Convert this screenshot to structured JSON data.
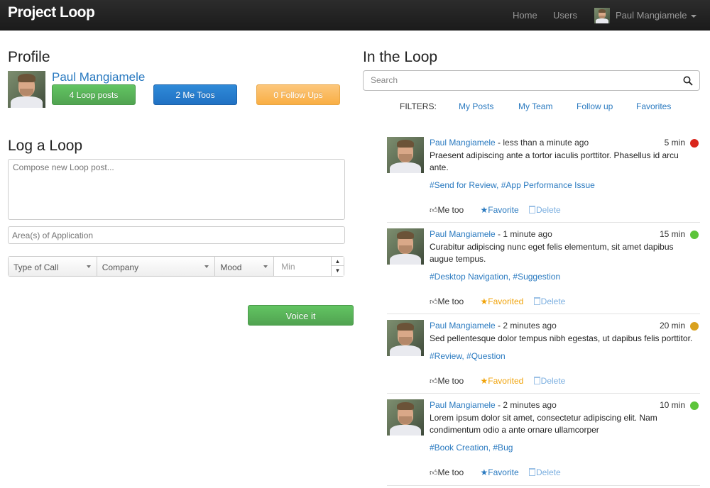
{
  "nav": {
    "brand": "Project Loop",
    "home": "Home",
    "users": "Users",
    "user_name": "Paul Mangiamele"
  },
  "profile": {
    "title": "Profile",
    "name": "Paul Mangiamele",
    "loop_posts": "4 Loop posts",
    "me_toos": "2 Me Toos",
    "follow_ups": "0 Follow Ups"
  },
  "log": {
    "title": "Log a Loop",
    "compose_placeholder": "Compose new Loop post...",
    "areas_placeholder": "Area(s) of Application",
    "type_of_call": "Type of Call",
    "company": "Company",
    "mood": "Mood",
    "min_placeholder": "Min",
    "voice_it": "Voice it"
  },
  "loop": {
    "title": "In the Loop",
    "search_placeholder": "Search",
    "filters_label": "FILTERS:",
    "filters": [
      "My Posts",
      "My Team",
      "Follow up",
      "Favorites"
    ]
  },
  "posts": [
    {
      "name": "Paul Mangiamele",
      "when": " - less than a minute ago",
      "duration": "5 min",
      "status_color": "#d9261c",
      "body": "Praesent adipiscing ante a tortor iaculis porttitor. Phasellus id arcu ante.",
      "tags": "#Send for Review, #App Performance Issue",
      "me_too": "Me  too",
      "favorite": "Favorite",
      "favorited": false,
      "delete": "Delete"
    },
    {
      "name": "Paul Mangiamele",
      "when": " - 1 minute ago",
      "duration": "15 min",
      "status_color": "#5cc43a",
      "body": "Curabitur adipiscing nunc eget felis elementum, sit amet dapibus augue tempus.",
      "tags": "#Desktop Navigation, #Suggestion",
      "me_too": "Me  too",
      "favorite": "Favorited",
      "favorited": true,
      "delete": "Delete"
    },
    {
      "name": "Paul Mangiamele",
      "when": " - 2 minutes ago",
      "duration": "20 min",
      "status_color": "#d9a11e",
      "body": "Sed pellentesque dolor tempus nibh egestas, ut dapibus felis porttitor.",
      "tags": "#Review, #Question",
      "me_too": "Me  too",
      "favorite": "Favorited",
      "favorited": true,
      "delete": "Delete"
    },
    {
      "name": "Paul Mangiamele",
      "when": " - 2 minutes ago",
      "duration": "10 min",
      "status_color": "#5cc43a",
      "body": "Lorem ipsum dolor sit amet, consectetur adipiscing elit. Nam condimentum odio a ante ornare ullamcorper",
      "tags": "#Book Creation, #Bug",
      "me_too": "Me  too",
      "favorite": "Favorite",
      "favorited": false,
      "delete": "Delete"
    }
  ]
}
